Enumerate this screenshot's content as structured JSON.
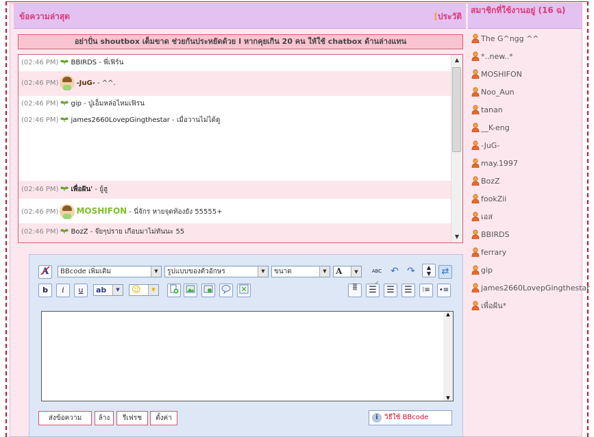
{
  "header": {
    "title": "ข้อความล่าสุด",
    "history_label": "ประวัติ"
  },
  "members_panel": {
    "title": "สมาชิกที่ใช้งานอยู่ (16 ฉ)",
    "members": [
      "The G^ngg ^^",
      "*..new..*",
      "MOSHIFON",
      "Noo_Aun",
      "tanan",
      "__K-eng",
      "-JuG-",
      "may.1997",
      "BozZ",
      "fookZii",
      "เอส",
      "BBIRDS",
      "ferrary",
      "gip",
      "james2660LovepGingthestar",
      "เพื่อฝัน*"
    ]
  },
  "notice": "อย่าปั่น shoutbox เต็มขาด ช่วยกันประหยัดด้วย I หากคุยเกิน 20 คน ให้ใช้ chatbox ด้านล่างแทน",
  "messages": [
    {
      "time": "(02:46 PM)",
      "user": "BBIRDS",
      "text": " - พี่เฟิร์น"
    },
    {
      "time": "(02:46 PM)",
      "user": "-JuG-",
      "text": " - ^^."
    },
    {
      "time": "(02:46 PM)",
      "user": "gip",
      "text": " - ปู่เอ็มหล่อไหมเฟิรน"
    },
    {
      "time": "(02:46 PM)",
      "user": "james2660LovepGingthestar",
      "text": " - เมื่อวานไม่ได้ดู"
    },
    {
      "time": "(02:46 PM)",
      "user": "เพื่อฝัน'",
      "text": " - ยู้ฮู"
    },
    {
      "time": "(02:46 PM)",
      "user": "MOSHIFON",
      "text": " - นี่จักร หายจุดท้องยัง 55555+"
    },
    {
      "time": "(02:46 PM)",
      "user": "BozZ",
      "text": " - จ๊ยๆปราย เกือบมาไม่ทันนะ 55"
    }
  ],
  "editor": {
    "bbcode_select": "BBcode เพิ่มเติม",
    "font_select": "รูปแบบของตัวอักษร",
    "size_select": "ขนาด",
    "bold_icon": "b",
    "italic_icon": "i",
    "underline_icon": "u",
    "font_color_icon": "A",
    "text_icon": "ab",
    "emoji_icon": "☺",
    "spell_icon": "ABC"
  },
  "buttons": {
    "send": "ส่งข้อความ",
    "clear": "ล้าง",
    "refresh": "รีเฟรช",
    "settings": "ตั้งค่า",
    "bbcode_help": "วิธีใช้ BBcode",
    "info_icon": "i"
  }
}
